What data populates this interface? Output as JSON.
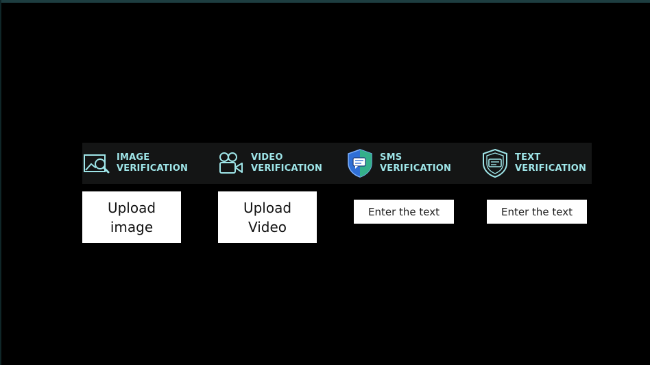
{
  "features": [
    {
      "line1": "IMAGE",
      "line2": "VERIFICATION",
      "icon": "image-search-icon"
    },
    {
      "line1": "VIDEO",
      "line2": "VERIFICATION",
      "icon": "video-camera-icon"
    },
    {
      "line1": "SMS",
      "line2": "VERIFICATION",
      "icon": "shield-message-icon"
    },
    {
      "line1": "TEXT",
      "line2": "VERIFICATION",
      "icon": "shield-text-icon"
    }
  ],
  "actions": {
    "upload_image": "Upload image",
    "upload_video": "Upload Video",
    "sms_placeholder": "Enter the text",
    "text_placeholder": "Enter the text"
  },
  "colors": {
    "background": "#000000",
    "banner": "#141515",
    "accent": "#9fe6e9",
    "shield_blue": "#2f6fd6",
    "shield_green": "#34b08a"
  }
}
